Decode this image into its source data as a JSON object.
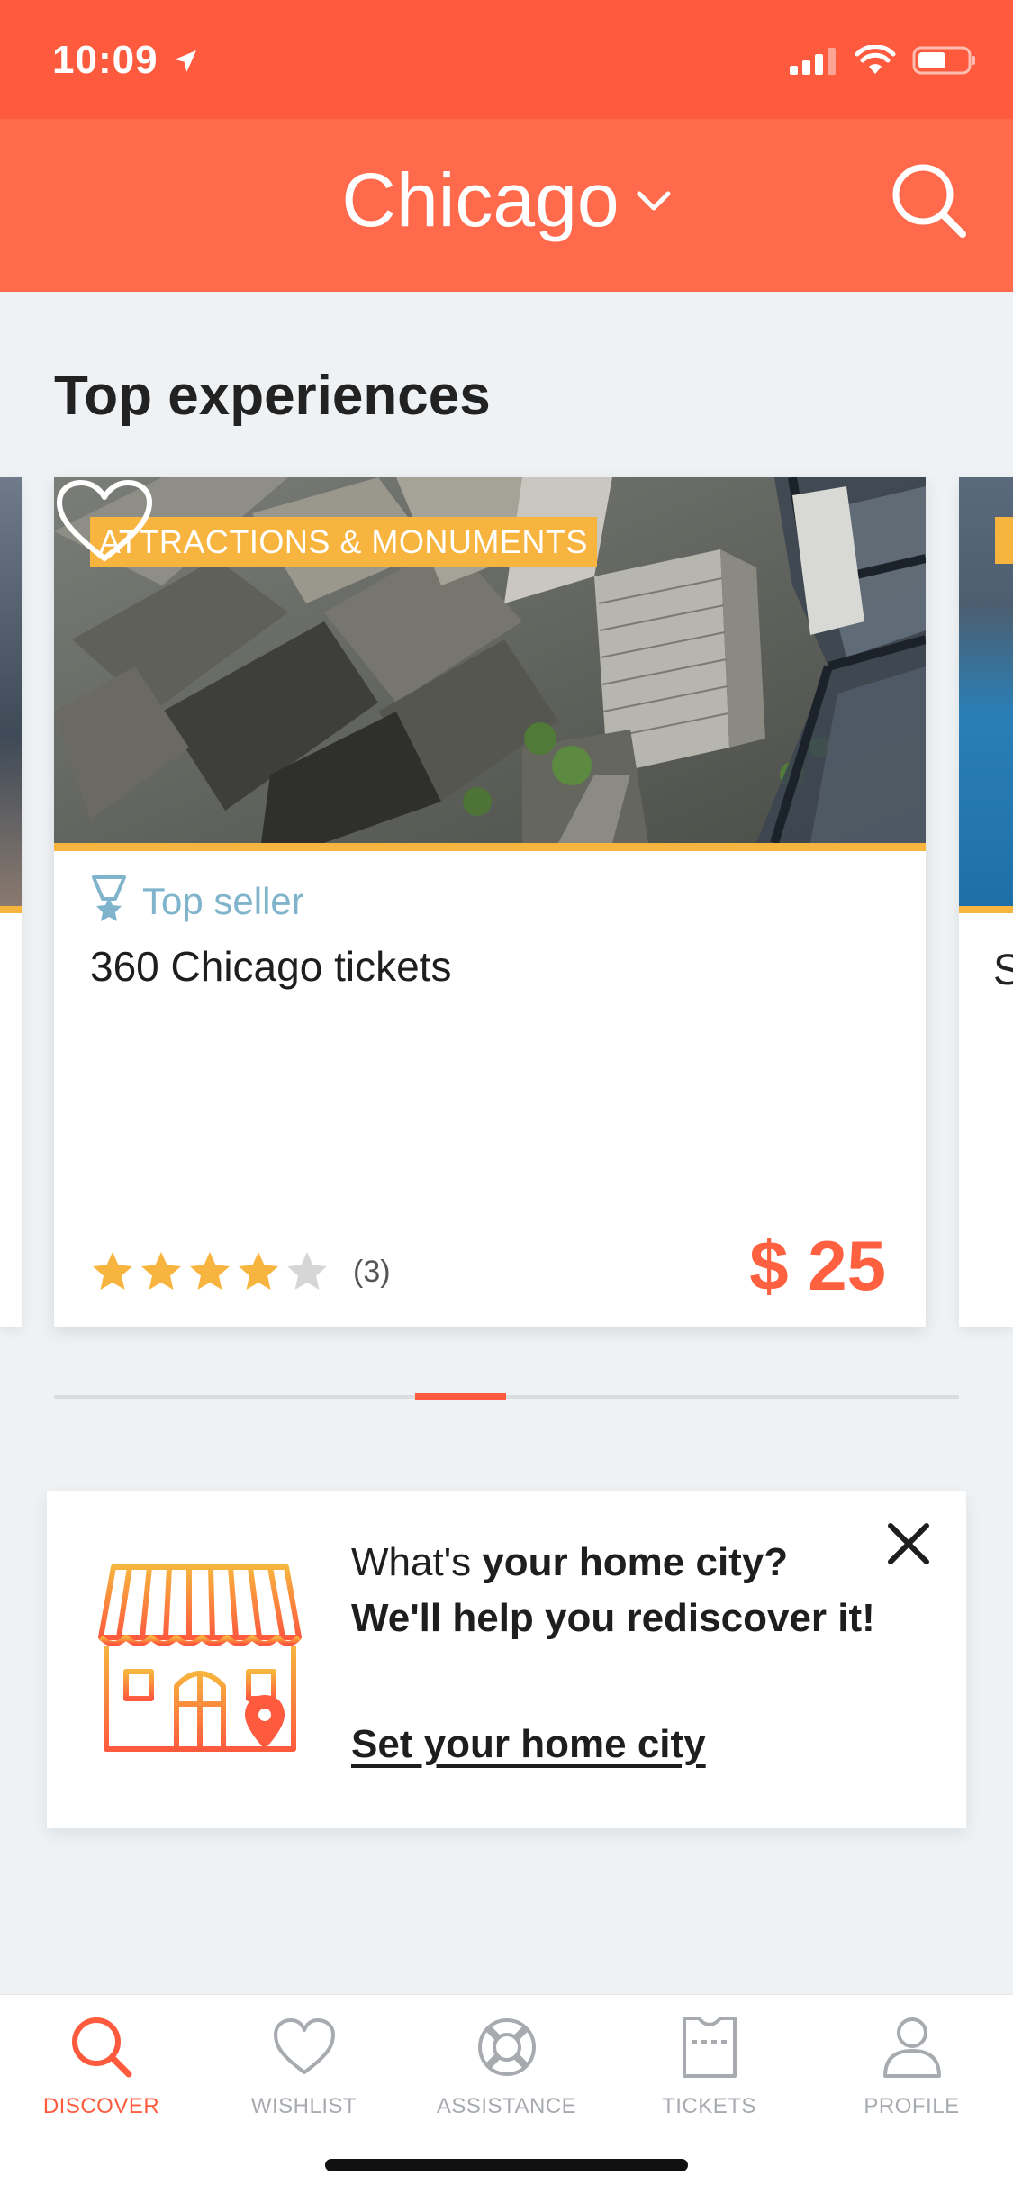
{
  "status_bar": {
    "time": "10:09",
    "icons": [
      "location-arrow-icon",
      "cellular-signal-icon",
      "wifi-icon",
      "battery-icon"
    ]
  },
  "header": {
    "city": "Chicago",
    "icons": [
      "chevron-down-icon",
      "search-icon"
    ]
  },
  "top_experiences": {
    "title": "Top experiences",
    "featured_card": {
      "category": "ATTRACTIONS & MONUMENTS",
      "badge": "Top seller",
      "title": "360 Chicago tickets",
      "rating": 4,
      "rating_max": 5,
      "review_count": "(3)",
      "price": "$ 25"
    },
    "next_card_title_initial": "S",
    "carousel_position": 0.4
  },
  "home_city_prompt": {
    "line1_prefix": "What's ",
    "line1_bold": "your home city?",
    "line2": "We'll help you rediscover it!",
    "link": "Set your home city"
  },
  "tab_bar": {
    "tabs": [
      {
        "id": "discover",
        "label": "DISCOVER",
        "icon": "search-icon",
        "active": true
      },
      {
        "id": "wishlist",
        "label": "WISHLIST",
        "icon": "heart-icon",
        "active": false
      },
      {
        "id": "assistance",
        "label": "ASSISTANCE",
        "icon": "lifebuoy-icon",
        "active": false
      },
      {
        "id": "tickets",
        "label": "TICKETS",
        "icon": "ticket-icon",
        "active": false
      },
      {
        "id": "profile",
        "label": "PROFILE",
        "icon": "user-icon",
        "active": false
      }
    ]
  },
  "colors": {
    "brand": "#fe5a3e",
    "header": "#ff6a4c",
    "tag": "#f7b43e",
    "badge": "#7fb4cc",
    "star": "#f7b43e",
    "star_empty": "#d6d6d6",
    "inactive": "#a7abb0"
  }
}
